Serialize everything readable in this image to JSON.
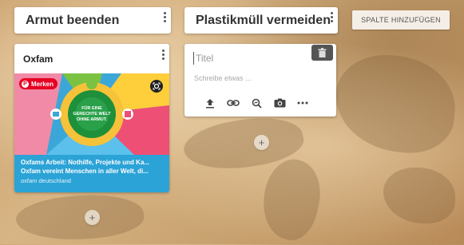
{
  "columns": [
    {
      "title": "Armut beenden"
    },
    {
      "title": "Plastikmüll vermeiden"
    }
  ],
  "add_column_label": "SPALTE HINZUFÜGEN",
  "card": {
    "title": "Oxfam",
    "pin_label": "Merken",
    "image_text": "FÜR EINE GERECHTE WELT OHNE ARMUT",
    "link_title": "Oxfams Arbeit: Nothilfe, Projekte und Ka...",
    "link_description": "Oxfam vereint Menschen in aller Welt, di...",
    "link_source": "oxfam deutschland"
  },
  "new_post": {
    "title_placeholder": "Titel",
    "body_placeholder": "Schreibe etwas ..."
  },
  "icons": [
    "more-vert-icon",
    "trash-icon",
    "upload-icon",
    "link-icon",
    "search-image-icon",
    "camera-icon",
    "more-horiz-icon",
    "add-icon",
    "lens-icon",
    "pinterest-icon"
  ],
  "colors": {
    "pin_red": "#e60023",
    "card_blue": "#2ba3d6",
    "trash_gray": "#555555"
  }
}
